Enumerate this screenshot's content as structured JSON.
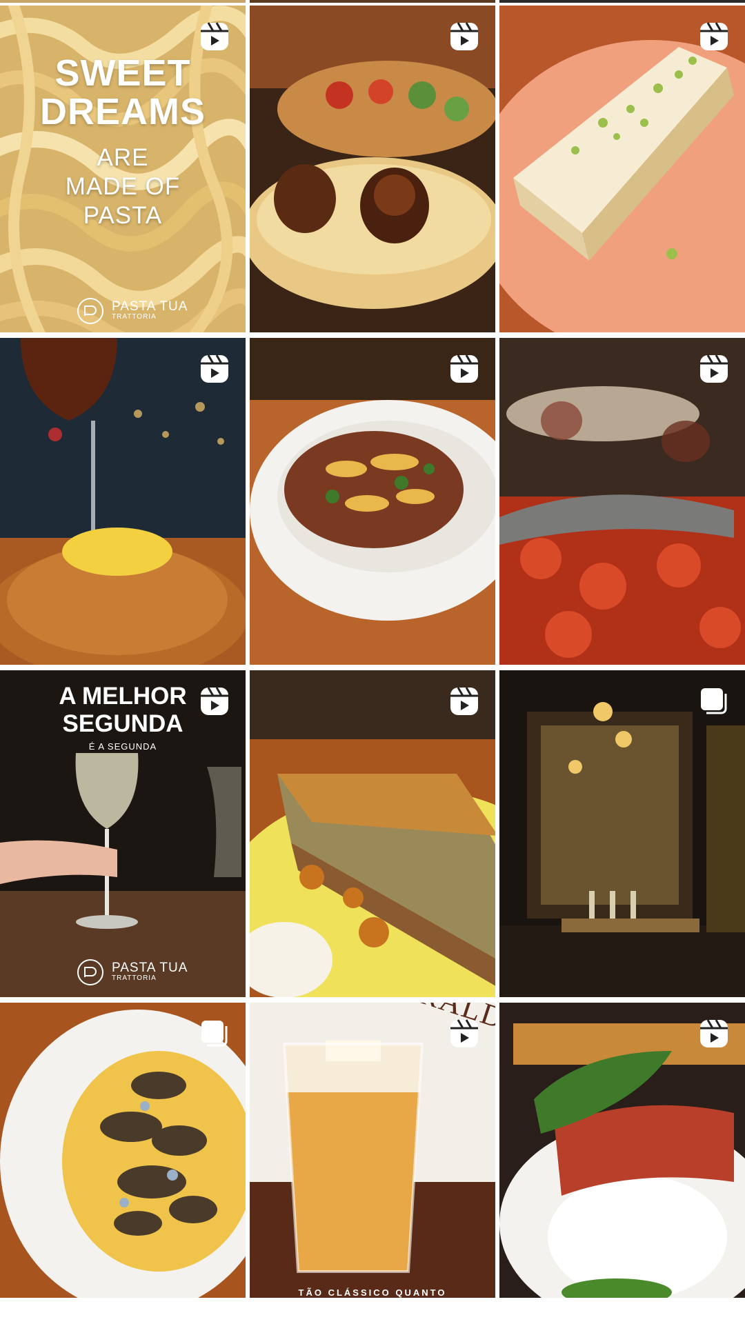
{
  "grid": {
    "tiles": [
      {
        "id": "1",
        "type": "reel",
        "title_lines": [
          "SWEET",
          "DREAMS"
        ],
        "subtitle_lines": [
          "ARE",
          "MADE OF",
          "PASTA"
        ],
        "brand": "PASTA TUA",
        "brand_tag": "TRATTORIA"
      },
      {
        "id": "2",
        "type": "reel"
      },
      {
        "id": "3",
        "type": "reel"
      },
      {
        "id": "4",
        "type": "reel"
      },
      {
        "id": "5",
        "type": "reel"
      },
      {
        "id": "6",
        "type": "reel"
      },
      {
        "id": "7",
        "type": "reel",
        "title_lines": [
          "A MELHOR",
          "SEGUNDA"
        ],
        "subtitle": "É A SEGUNDA",
        "brand": "PASTA TUA",
        "brand_tag": "TRATTORIA"
      },
      {
        "id": "8",
        "type": "reel"
      },
      {
        "id": "9",
        "type": "carousel"
      },
      {
        "id": "10",
        "type": "carousel"
      },
      {
        "id": "11",
        "type": "reel",
        "heading": "FITZGERALD",
        "bottom_text": "TÃO CLÁSSICO QUANTO"
      },
      {
        "id": "12",
        "type": "reel"
      }
    ]
  },
  "icons": {
    "reel": "reels-icon",
    "carousel": "carousel-icon"
  }
}
